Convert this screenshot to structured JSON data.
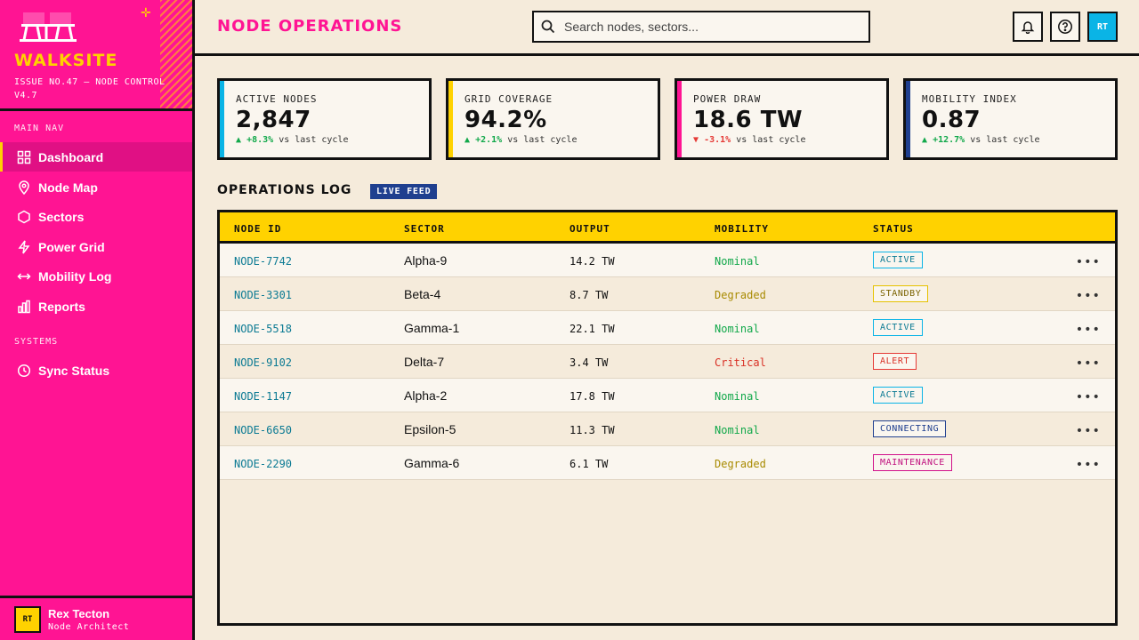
{
  "brand": {
    "name": "WALKSITE",
    "subtitle": "ISSUE NO.47 — NODE CONTROL V4.7",
    "colors": {
      "primary": "#ff1493",
      "accent": "#ffd200",
      "cyan": "#0ab4e6",
      "navy": "#1f3f8f"
    }
  },
  "sidebar": {
    "main_nav_label": "MAIN NAV",
    "items": [
      {
        "label": "Dashboard",
        "icon": "grid-icon",
        "active": true
      },
      {
        "label": "Node Map",
        "icon": "map-pin-icon"
      },
      {
        "label": "Sectors",
        "icon": "hexagon-icon"
      },
      {
        "label": "Power Grid",
        "icon": "bolt-icon"
      },
      {
        "label": "Mobility Log",
        "icon": "arrows-horizontal-icon"
      },
      {
        "label": "Reports",
        "icon": "bar-chart-icon"
      }
    ],
    "systems_label": "SYSTEMS",
    "system_items": [
      {
        "label": "Sync Status",
        "icon": "clock-icon"
      }
    ]
  },
  "user": {
    "initials": "RT",
    "name": "Rex Tecton",
    "role": "Node Architect"
  },
  "header": {
    "title": "NODE OPERATIONS",
    "search_placeholder": "Search nodes, sectors...",
    "avatar_initials": "RT"
  },
  "stats": [
    {
      "label": "ACTIVE NODES",
      "value": "2,847",
      "delta": "+8.3%",
      "direction": "up",
      "suffix": "vs last cycle",
      "color": "#0ab4e6"
    },
    {
      "label": "GRID COVERAGE",
      "value": "94.2%",
      "delta": "+2.1%",
      "direction": "up",
      "suffix": "vs last cycle",
      "color": "#ffd200"
    },
    {
      "label": "POWER DRAW",
      "value": "18.6 TW",
      "delta": "-3.1%",
      "direction": "down",
      "suffix": "vs last cycle",
      "color": "#ff1493"
    },
    {
      "label": "MOBILITY INDEX",
      "value": "0.87",
      "delta": "+12.7%",
      "direction": "up",
      "suffix": "vs last cycle",
      "color": "#1f3f8f"
    }
  ],
  "log": {
    "title": "OPERATIONS LOG",
    "badge": "LIVE FEED",
    "columns": [
      "NODE ID",
      "SECTOR",
      "OUTPUT",
      "MOBILITY",
      "STATUS"
    ],
    "rows": [
      {
        "id": "NODE-7742",
        "sector": "Alpha-9",
        "output": "14.2 TW",
        "mobility": "Nominal",
        "status": "ACTIVE"
      },
      {
        "id": "NODE-3301",
        "sector": "Beta-4",
        "output": "8.7 TW",
        "mobility": "Degraded",
        "status": "STANDBY"
      },
      {
        "id": "NODE-5518",
        "sector": "Gamma-1",
        "output": "22.1 TW",
        "mobility": "Nominal",
        "status": "ACTIVE"
      },
      {
        "id": "NODE-9102",
        "sector": "Delta-7",
        "output": "3.4 TW",
        "mobility": "Critical",
        "status": "ALERT"
      },
      {
        "id": "NODE-1147",
        "sector": "Alpha-2",
        "output": "17.8 TW",
        "mobility": "Nominal",
        "status": "ACTIVE"
      },
      {
        "id": "NODE-6650",
        "sector": "Epsilon-5",
        "output": "11.3 TW",
        "mobility": "Nominal",
        "status": "CONNECTING"
      },
      {
        "id": "NODE-2290",
        "sector": "Gamma-6",
        "output": "6.1 TW",
        "mobility": "Degraded",
        "status": "MAINTENANCE"
      }
    ],
    "mobility_colors": {
      "Nominal": "#11a84a",
      "Degraded": "#a88a00",
      "Critical": "#d93025"
    },
    "status_colors": {
      "ACTIVE": "#0ab4e6",
      "STANDBY": "#e6c200",
      "ALERT": "#e53935",
      "CONNECTING": "#1f3f8f",
      "MAINTENANCE": "#d1108a"
    },
    "status_text_colors": {
      "ACTIVE": "#0b7a93",
      "STANDBY": "#7a6200",
      "ALERT": "#d93025",
      "CONNECTING": "#1f3f8f",
      "MAINTENANCE": "#c0107e"
    }
  }
}
